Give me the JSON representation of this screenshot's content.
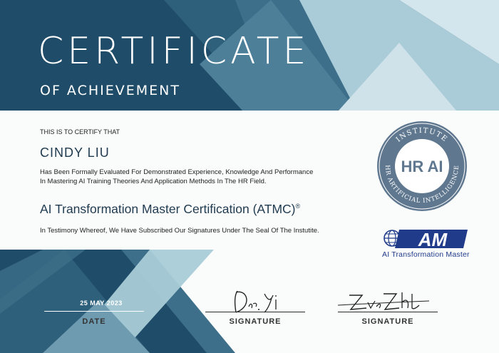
{
  "header": {
    "title": "CERTIFICATE",
    "subtitle": "OF ACHIEVEMENT"
  },
  "body": {
    "intro": "THIS IS TO CERTIFY THAT",
    "recipient_name": "CINDY LIU",
    "description_line1": "Has Been Formally Evaluated For Demonstrated Experience, Knowledge And Performance",
    "description_line2": "In Mastering AI Training Theories And Application Methods In The HR Field.",
    "certification_title": "AI Transformation Master Certification (ATMC)",
    "certification_mark": "®",
    "testimony": "In Testimony Whereof, We Have Subscribed Our Signatures Under The Seal Of The Instutite."
  },
  "seal": {
    "top_text": "INSTITUTE",
    "bottom_text": "HR ARTIFICIAL INTELLIGENCE",
    "center_text": "HR AI"
  },
  "logo": {
    "mark": "AM",
    "caption": "AI Transformation Master"
  },
  "footer": {
    "date_value": "25 MAY 2023",
    "date_label": "DATE",
    "signature1_label": "SIGNATURE",
    "signature2_label": "SIGNATURE"
  },
  "colors": {
    "dark_teal": "#1e4b66",
    "mid_teal": "#3d6f8a",
    "light_blue": "#a9ccd8",
    "pale_blue": "#cfe2e9",
    "navy_text": "#1f3a4f",
    "logo_blue": "#1f3b8a"
  }
}
